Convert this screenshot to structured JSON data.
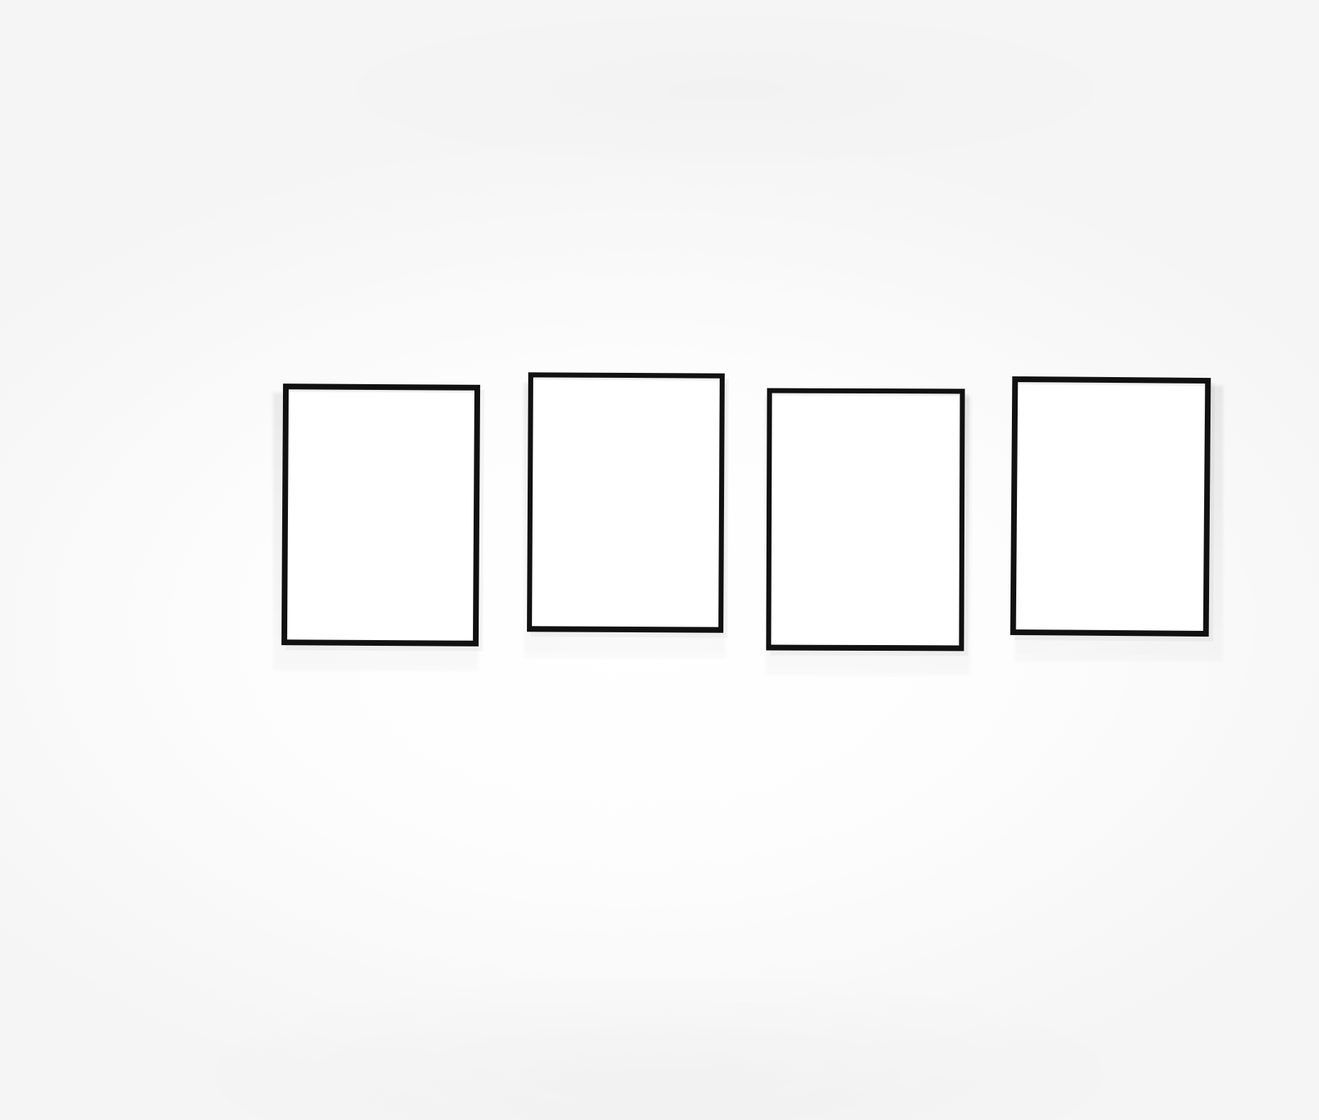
{
  "scene": {
    "background_color": "#fafafa",
    "frame_color": "#111111",
    "frame_count": 4
  },
  "frames": [
    {
      "label": "",
      "color": "#111111"
    },
    {
      "label": "",
      "color": "#111111"
    },
    {
      "label": "",
      "color": "#111111"
    },
    {
      "label": "",
      "color": "#111111"
    }
  ]
}
